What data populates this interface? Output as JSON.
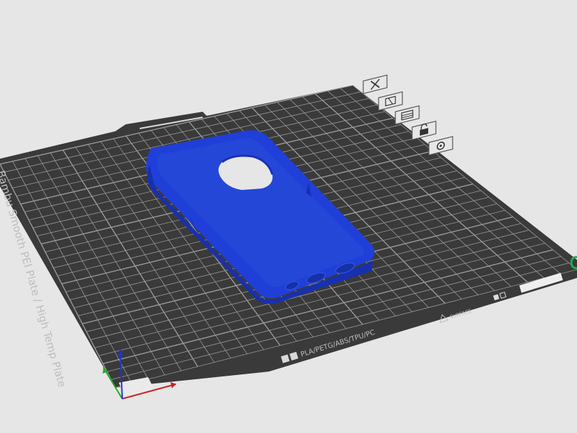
{
  "plate": {
    "side_label": "Bambu Smooth PEI Plate / High Temp Plate",
    "filament_label": "PLA/PETG/ABS/TPU/PC",
    "surface_label": "SURFACE",
    "bed_color": "#3a3a3a",
    "grid_color": "#9a9a9a"
  },
  "model": {
    "name": "phone-case",
    "color": "#1f3fd8"
  },
  "plate_toolbar": {
    "items": [
      {
        "name": "close-icon"
      },
      {
        "name": "orient-icon"
      },
      {
        "name": "arrange-icon"
      },
      {
        "name": "lock-icon"
      },
      {
        "name": "settings-icon"
      }
    ]
  },
  "axes": {
    "x_color": "#cc2222",
    "y_color": "#22aa22",
    "z_color": "#2233cc"
  }
}
